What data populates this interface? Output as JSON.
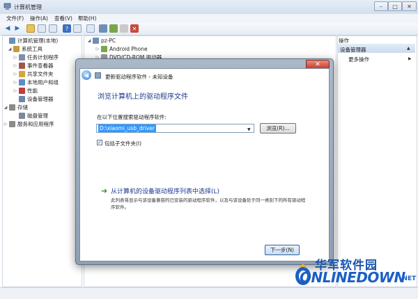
{
  "window": {
    "title": "计算机管理",
    "controls": [
      "–",
      "□",
      "✕"
    ]
  },
  "menu": [
    "文件(F)",
    "操作(A)",
    "查看(V)",
    "帮助(H)"
  ],
  "tree": [
    {
      "label": "计算机管理(本地)",
      "indent": 0,
      "twisty": "",
      "icon": "computer-icon",
      "color": "#6c8fb8"
    },
    {
      "label": "系统工具",
      "indent": 1,
      "twisty": "◢",
      "icon": "tools-icon",
      "color": "#c89a3a"
    },
    {
      "label": "任务计划程序",
      "indent": 2,
      "twisty": "▷",
      "icon": "clock-icon",
      "color": "#7e8fa6"
    },
    {
      "label": "事件查看器",
      "indent": 2,
      "twisty": "▷",
      "icon": "event-log-icon",
      "color": "#a3574a"
    },
    {
      "label": "共享文件夹",
      "indent": 2,
      "twisty": "▷",
      "icon": "shared-folder-icon",
      "color": "#d4a838"
    },
    {
      "label": "本地用户和组",
      "indent": 2,
      "twisty": "▷",
      "icon": "users-icon",
      "color": "#5a8fc8"
    },
    {
      "label": "性能",
      "indent": 2,
      "twisty": "▷",
      "icon": "performance-icon",
      "color": "#c43d3d"
    },
    {
      "label": "设备管理器",
      "indent": 2,
      "twisty": "",
      "icon": "device-manager-icon",
      "color": "#6a86a8"
    },
    {
      "label": "存储",
      "indent": 1,
      "twisty": "◢",
      "icon": "storage-icon",
      "color": "#8a8a8a"
    },
    {
      "label": "磁盘管理",
      "indent": 2,
      "twisty": "",
      "icon": "disk-icon",
      "color": "#7b8b9e"
    },
    {
      "label": "服务和应用程序",
      "indent": 1,
      "twisty": "▷",
      "icon": "services-icon",
      "color": "#8c8c8c"
    }
  ],
  "devices": [
    {
      "label": "pz-PC",
      "twisty": "◢",
      "icon": "computer-icon"
    },
    {
      "label": "Android Phone",
      "twisty": "▷",
      "icon": "phone-icon"
    },
    {
      "label": "DVD/CD-ROM 驱动器",
      "twisty": "▷",
      "icon": "dvd-icon"
    }
  ],
  "actions": {
    "title": "操作",
    "group": "设备管理器",
    "more": "更多操作"
  },
  "dialog": {
    "title": "更新驱动程序软件 - 未知设备",
    "close": "✕",
    "heading": "浏览计算机上的驱动程序文件",
    "path_label": "在以下位置搜索驱动程序软件:",
    "path_value": "D:\\xiaomi_usb_driver",
    "browse": "浏览(R)...",
    "include_sub": "包括子文件夹(I)",
    "include_checked": true,
    "option_title": "从计算机的设备驱动程序列表中选择(L)",
    "option_desc": "此列表将显示与该设备兼容的已安装的驱动程序软件，以及与该设备处于同一类别下的所有驱动程序软件。",
    "next": "下一步(N)"
  },
  "watermark": {
    "cn": "华军软件园",
    "en": "ONLINEDOWN",
    "net": ".NET"
  },
  "colors": {
    "accent": "#1a3a8a",
    "selection": "#3399ff",
    "watermark": "#1b5fc4"
  }
}
